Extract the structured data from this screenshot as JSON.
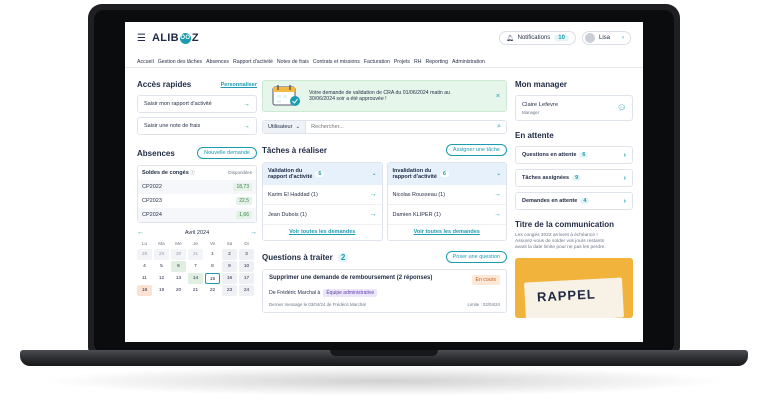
{
  "header": {
    "logo_left": "ALIB",
    "logo_mid": "OO",
    "logo_right": "Z",
    "notifications_label": "Notifications",
    "notifications_count": "10",
    "user_name": "Lisa"
  },
  "nav": [
    "Accueil",
    "Gestion des tâches",
    "Absences",
    "Rapport d'activité",
    "Notes de frais",
    "Contrats et missions",
    "Facturation",
    "Projets",
    "RH",
    "Reporting",
    "Administration"
  ],
  "quick": {
    "title": "Accès rapides",
    "customize": "Personnaliser",
    "items": [
      "Saisir mon rapport d'activité",
      "Saisir une note de frais"
    ]
  },
  "absences": {
    "title": "Absences",
    "new_button": "Nouvelle demande",
    "table_title": "Soldes de congés",
    "table_col": "Disponibles",
    "rows": [
      {
        "label": "CP2022",
        "value": "18,73"
      },
      {
        "label": "CP2023",
        "value": "22,5"
      },
      {
        "label": "CP2024",
        "value": "1,66"
      }
    ],
    "month": "Avril 2024",
    "weekdays": [
      "Lu",
      "Ma",
      "Me",
      "Je",
      "Ve",
      "Sa",
      "Di"
    ],
    "days": [
      {
        "d": "28",
        "t": "m"
      },
      {
        "d": "29",
        "t": "m"
      },
      {
        "d": "30",
        "t": "m"
      },
      {
        "d": "31",
        "t": "m"
      },
      {
        "d": "1",
        "t": ""
      },
      {
        "d": "2",
        "t": "we"
      },
      {
        "d": "3",
        "t": "we"
      },
      {
        "d": "4",
        "t": ""
      },
      {
        "d": "5",
        "t": ""
      },
      {
        "d": "6",
        "t": "g"
      },
      {
        "d": "7",
        "t": ""
      },
      {
        "d": "8",
        "t": ""
      },
      {
        "d": "9",
        "t": "we"
      },
      {
        "d": "10",
        "t": "we"
      },
      {
        "d": "11",
        "t": ""
      },
      {
        "d": "12",
        "t": ""
      },
      {
        "d": "13",
        "t": ""
      },
      {
        "d": "14",
        "t": "g"
      },
      {
        "d": "15",
        "t": "sel"
      },
      {
        "d": "16",
        "t": "we"
      },
      {
        "d": "17",
        "t": "we"
      },
      {
        "d": "18",
        "t": "o"
      },
      {
        "d": "19",
        "t": ""
      },
      {
        "d": "20",
        "t": ""
      },
      {
        "d": "21",
        "t": ""
      },
      {
        "d": "22",
        "t": ""
      },
      {
        "d": "23",
        "t": "we"
      },
      {
        "d": "24",
        "t": "we"
      }
    ]
  },
  "alert": {
    "line1": "Votre demande de validation de CRA du 01/06/2024 matin au",
    "line2": "30/06/2024 soir a été approuvée !"
  },
  "search": {
    "filter": "Utilisateur",
    "placeholder": "Rechercher..."
  },
  "tasks": {
    "title": "Tâches à réaliser",
    "assign_button": "Assigner une tâche",
    "columns": [
      {
        "title_line1": "Validation du",
        "title_line2": "rapport d'activité",
        "count": "6",
        "rows": [
          "Karim El Haddad  (1)",
          "Jean Dubois  (1)"
        ],
        "footer": "Voir toutes les demandes"
      },
      {
        "title_line1": "Invalidation du",
        "title_line2": "rapport d'activité",
        "count": "6",
        "rows": [
          "Nicolas Rousseau  (1)",
          "Damien KLIPER  (1)"
        ],
        "footer": "Voir toutes les demandes"
      }
    ]
  },
  "questions": {
    "title": "Questions à traiter",
    "count": "2",
    "ask_button": "Poser une question",
    "card": {
      "title": "Supprimer une demande de remboursement (2 réponses)",
      "status": "En cours",
      "from": "De Frédéric Marchal à",
      "team": "Équipe administrative",
      "last_message": "Dernier message le 03/04/24 de Frédéric Marchal",
      "deadline": "Limite : 02/04/24"
    }
  },
  "manager": {
    "title": "Mon manager",
    "name": "Claire Lefevre",
    "role": "Manager"
  },
  "pending": {
    "title": "En attente",
    "items": [
      {
        "label": "Questions en attente",
        "count": "6"
      },
      {
        "label": "Tâches assignées",
        "count": "9"
      },
      {
        "label": "Demandes en attente",
        "count": "4"
      }
    ]
  },
  "communication": {
    "title": "Titre de la communication",
    "text1": "Les congés 2022 arrivent à échéance !",
    "text2": "Assurez-vous de solder vos jours restants",
    "text3": "avant la date limite pour ne pas les perdre.",
    "banner": "RAPPEL"
  }
}
